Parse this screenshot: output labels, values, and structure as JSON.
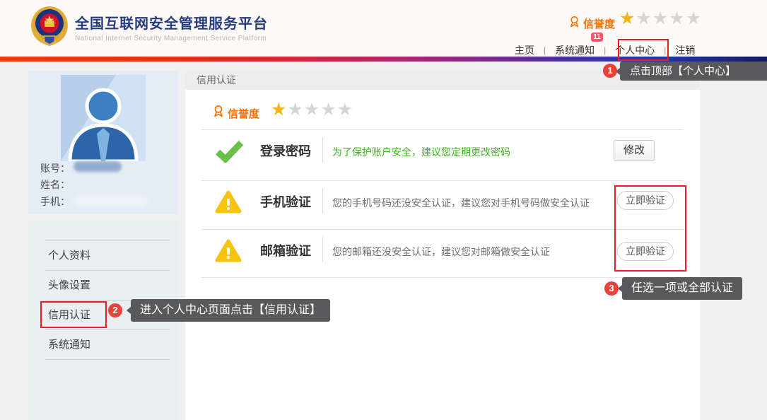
{
  "brand": {
    "title": "全国互联网安全管理服务平台",
    "subtitle": "National Internet Security Management Service Platform"
  },
  "stars": {
    "filled": 1,
    "total": 5
  },
  "header": {
    "reputation_label": "信誉度",
    "badge_count": "11",
    "separator": "|",
    "nav_home": "主页",
    "nav_notice": "系统通知",
    "nav_center": "个人中心",
    "nav_logout": "注销"
  },
  "sidebar": {
    "account_label": "账号：",
    "name_label": "姓名：",
    "phone_label": "手机：",
    "menu": {
      "profile": "个人资料",
      "avatar": "头像设置",
      "credit": "信用认证",
      "notice": "系统通知"
    }
  },
  "main": {
    "panel_title": "信用认证",
    "reputation_label": "信誉度",
    "rows": [
      {
        "title": "登录密码",
        "desc": "为了保护账户安全，建议您定期更改密码",
        "button": "修改"
      },
      {
        "title": "手机验证",
        "desc": "您的手机号码还没安全认证，建议您对手机号码做安全认证",
        "button": "立即验证"
      },
      {
        "title": "邮箱验证",
        "desc": "您的邮箱还没安全认证，建议您对邮箱做安全认证",
        "button": "立即验证"
      }
    ]
  },
  "annotations": {
    "step1": {
      "num": "1",
      "text": "点击顶部【个人中心】"
    },
    "step2": {
      "num": "2",
      "text": "进入个人中心页面点击【信用认证】"
    },
    "step3": {
      "num": "3",
      "text": "任选一项或全部认证"
    }
  },
  "colors": {
    "accent_orange": "#ff6f00",
    "star_gold": "#f7b30d",
    "star_gray": "#d5d5d5",
    "success_green": "#6abf4a",
    "warning_yellow": "#f6c40e",
    "annotation_red": "#ed1c24",
    "tooltip_gray": "#59595b",
    "brand_navy": "#263c7e"
  }
}
